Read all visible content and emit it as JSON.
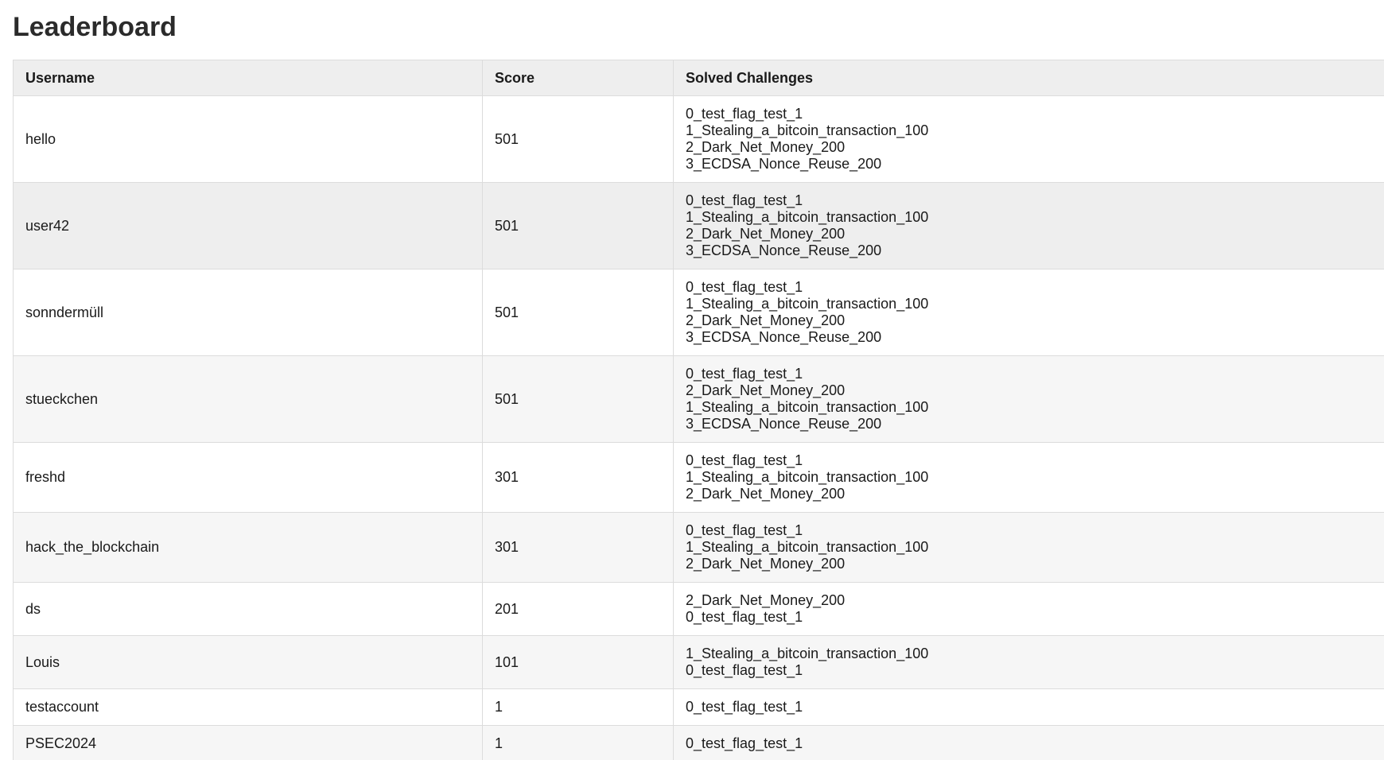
{
  "page": {
    "title": "Leaderboard"
  },
  "table": {
    "headers": {
      "username": "Username",
      "score": "Score",
      "solved": "Solved Challenges"
    },
    "rows": [
      {
        "username": "hello",
        "score": "501",
        "challenges": [
          "0_test_flag_test_1",
          "1_Stealing_a_bitcoin_transaction_100",
          "2_Dark_Net_Money_200",
          "3_ECDSA_Nonce_Reuse_200"
        ]
      },
      {
        "username": "user42",
        "score": "501",
        "challenges": [
          "0_test_flag_test_1",
          "1_Stealing_a_bitcoin_transaction_100",
          "2_Dark_Net_Money_200",
          "3_ECDSA_Nonce_Reuse_200"
        ]
      },
      {
        "username": "sonndermüll",
        "score": "501",
        "challenges": [
          "0_test_flag_test_1",
          "1_Stealing_a_bitcoin_transaction_100",
          "2_Dark_Net_Money_200",
          "3_ECDSA_Nonce_Reuse_200"
        ]
      },
      {
        "username": "stueckchen",
        "score": "501",
        "challenges": [
          "0_test_flag_test_1",
          "2_Dark_Net_Money_200",
          "1_Stealing_a_bitcoin_transaction_100",
          "3_ECDSA_Nonce_Reuse_200"
        ]
      },
      {
        "username": "freshd",
        "score": "301",
        "challenges": [
          "0_test_flag_test_1",
          "1_Stealing_a_bitcoin_transaction_100",
          "2_Dark_Net_Money_200"
        ]
      },
      {
        "username": "hack_the_blockchain",
        "score": "301",
        "challenges": [
          "0_test_flag_test_1",
          "1_Stealing_a_bitcoin_transaction_100",
          "2_Dark_Net_Money_200"
        ]
      },
      {
        "username": "ds",
        "score": "201",
        "challenges": [
          "2_Dark_Net_Money_200",
          "0_test_flag_test_1"
        ]
      },
      {
        "username": "Louis",
        "score": "101",
        "challenges": [
          "1_Stealing_a_bitcoin_transaction_100",
          "0_test_flag_test_1"
        ]
      },
      {
        "username": "testaccount",
        "score": "1",
        "challenges": [
          "0_test_flag_test_1"
        ]
      },
      {
        "username": "PSEC2024",
        "score": "1",
        "challenges": [
          "0_test_flag_test_1"
        ]
      }
    ]
  }
}
